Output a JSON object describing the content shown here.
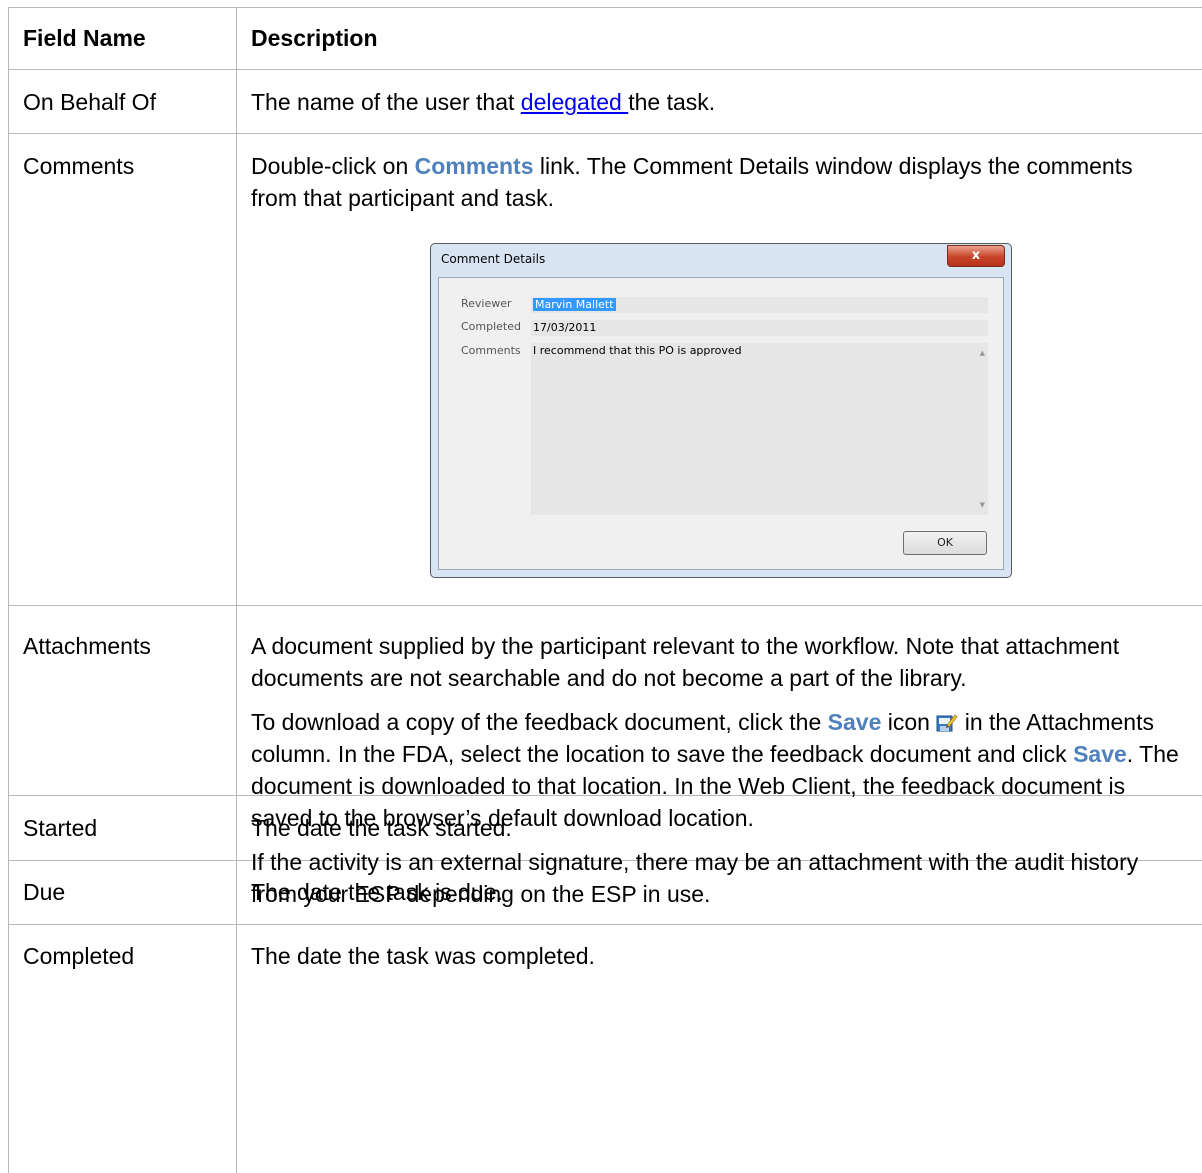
{
  "table": {
    "headers": {
      "field": "Field Name",
      "description": "Description"
    },
    "rows": {
      "on_behalf_of": {
        "field": "On Behalf Of",
        "desc_before": "The name of the user that ",
        "desc_link": "delegated ",
        "desc_after": "the task."
      },
      "comments": {
        "field": "Comments",
        "desc_before": "Double-click on ",
        "desc_ref": "Comments",
        "desc_after": " link. The Comment Details window displays the comments from that participant and task."
      },
      "attachments": {
        "field": "Attachments",
        "p1": "A document supplied by the participant relevant to the workflow. Note that attachment documents are not searchable and do not become a part of the library.",
        "p2_a": "To download a copy of the feedback document, click the ",
        "p2_ref1": "Save",
        "p2_b": " icon ",
        "p2_c": " in the Attachments column. In the FDA, select the location to save the feedback document and click ",
        "p2_ref2": "Save",
        "p2_d": ". The document is downloaded to that location. In the Web Client, the feedback document is saved to the browser’s default download location.",
        "p3": "If the activity is an external signature, there may be an attachment with the audit history from your ESP depending on the ESP in use."
      },
      "started": {
        "field": "Started",
        "desc": "The date the task started."
      },
      "due": {
        "field": "Due",
        "desc": "The date the task is due."
      },
      "completed": {
        "field": "Completed",
        "desc": "The date the task was completed."
      }
    }
  },
  "dialog": {
    "title": "Comment Details",
    "close_label": "x",
    "reviewer_label": "Reviewer",
    "reviewer_value": "Marvin Mallett",
    "completed_label": "Completed",
    "completed_value": "17/03/2011",
    "comments_label": "Comments",
    "comments_value": "I recommend that this PO is approved",
    "ok_label": "OK"
  },
  "icons": {
    "save": "save-icon"
  },
  "colors": {
    "ui_reference": "#4f81bd",
    "link": "#0000ee",
    "grid": "#b8b8b8"
  }
}
